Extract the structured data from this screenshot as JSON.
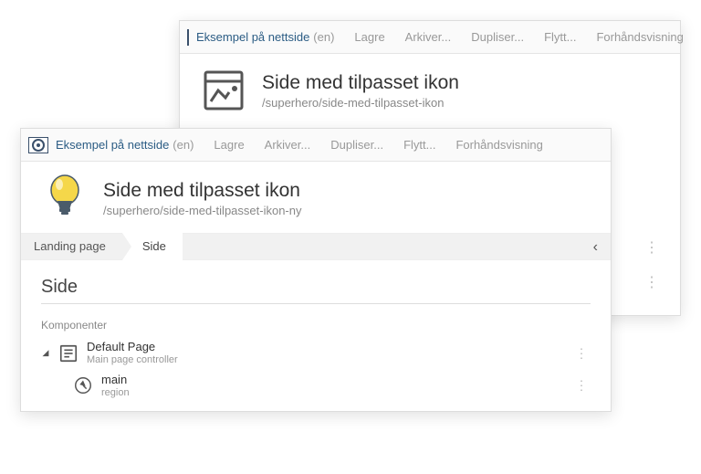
{
  "back": {
    "site_name": "Eksempel på nettside",
    "lang": "(en)",
    "actions": [
      "Lagre",
      "Arkiver...",
      "Dupliser...",
      "Flytt...",
      "Forhåndsvisning"
    ],
    "title": "Side med tilpasset ikon",
    "path": "/superhero/side-med-tilpasset-ikon"
  },
  "front": {
    "site_name": "Eksempel på nettside",
    "lang": "(en)",
    "actions": [
      "Lagre",
      "Arkiver...",
      "Dupliser...",
      "Flytt...",
      "Forhåndsvisning"
    ],
    "title": "Side med tilpasset ikon",
    "path": "/superhero/side-med-tilpasset-ikon-ny",
    "breadcrumb": {
      "root": "Landing page",
      "current": "Side"
    },
    "section_title": "Side",
    "components_label": "Komponenter",
    "tree": {
      "root": {
        "label": "Default Page",
        "sub": "Main page controller"
      },
      "child": {
        "label": "main",
        "sub": "region"
      }
    }
  }
}
